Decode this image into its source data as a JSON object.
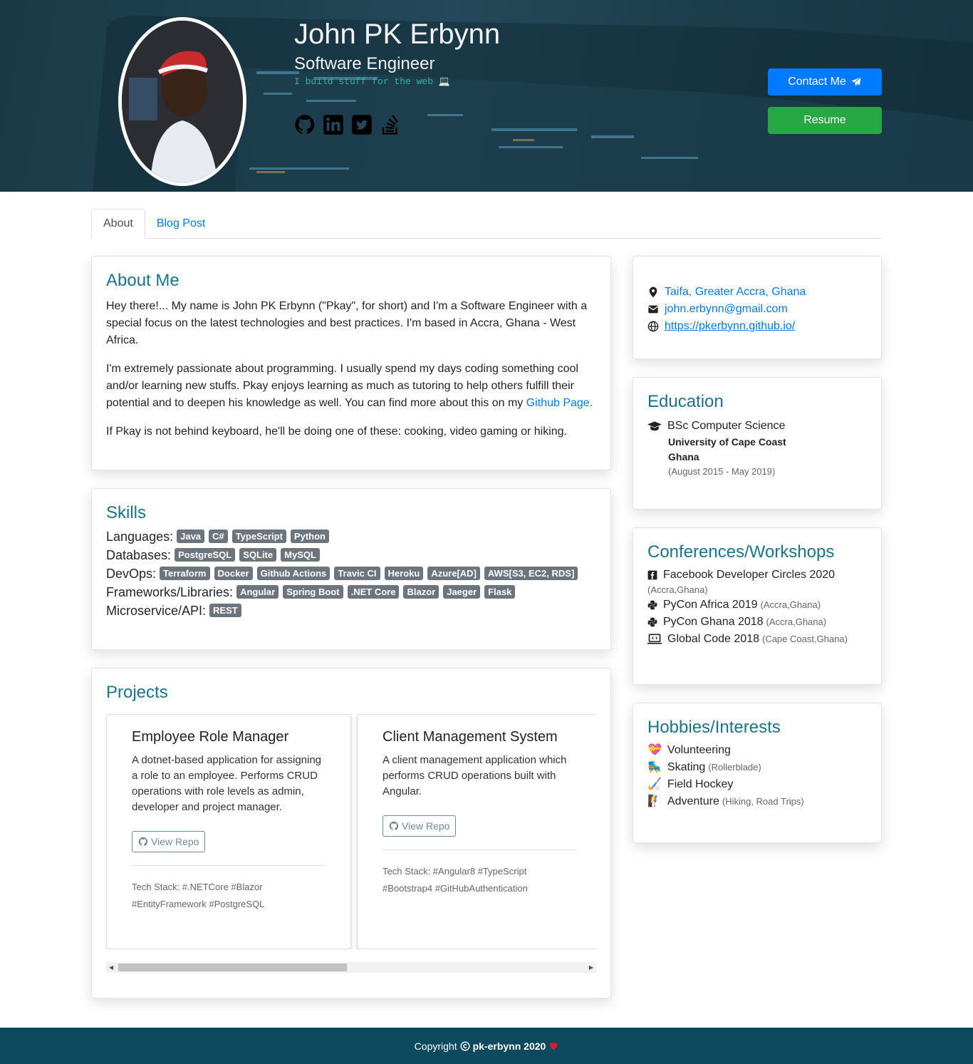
{
  "header": {
    "name": "John PK Erbynn",
    "role": "Software Engineer",
    "tagline": "I build stuff for the web 💻",
    "socials": [
      "github-icon",
      "linkedin-icon",
      "twitter-icon",
      "stackoverflow-icon"
    ],
    "contact_label": "Contact Me",
    "resume_label": "Resume"
  },
  "tabs": [
    {
      "label": "About",
      "active": true
    },
    {
      "label": "Blog Post",
      "active": false
    }
  ],
  "about": {
    "title": "About Me",
    "p1": "Hey there!... My name is John PK Erbynn (\"Pkay\", for short) and I'm a Software Engineer with a special focus on the latest technologies and best practices. I'm based in Accra, Ghana - West Africa.",
    "p2": "I'm extremely passionate about programming. I usually spend my days coding something cool and/or learning new stuffs. Pkay enjoys learning as much as tutoring to help others fulfill their potential and to deepen his knowledge as well. You can find more about this on my ",
    "p2_link": "Github Page.",
    "p3": "If Pkay is not behind keyboard, he'll be doing one of these: cooking, video gaming or hiking."
  },
  "skills": {
    "title": "Skills",
    "rows": [
      {
        "label": "Languages:",
        "items": [
          "Java",
          "C#",
          "TypeScript",
          "Python"
        ]
      },
      {
        "label": "Databases:",
        "items": [
          "PostgreSQL",
          "SQLite",
          "MySQL"
        ]
      },
      {
        "label": "DevOps:",
        "items": [
          "Terraform",
          "Docker",
          "Github Actions",
          "Travic CI",
          "Heroku",
          "Azure[AD]",
          "AWS[S3, EC2, RDS]"
        ]
      },
      {
        "label": "Frameworks/Libraries:",
        "items": [
          "Angular",
          "Spring Boot",
          ".NET Core",
          "Blazor",
          "Jaeger",
          "Flask"
        ]
      },
      {
        "label": "Microservice/API:",
        "items": [
          "REST"
        ]
      }
    ]
  },
  "projects": {
    "title": "Projects",
    "items": [
      {
        "name": "Employee Role Manager",
        "desc": "A dotnet-based application for assigning a role to an employee. Performs CRUD operations with role levels as admin, developer and project manager.",
        "repo_label": "View Repo",
        "tech_label": "Tech Stack: #.NETCore #Blazor #EntityFramework #PostgreSQL"
      },
      {
        "name": "Client Management System",
        "desc": "A client management application which performs CRUD operations built with Angular.",
        "repo_label": "View Repo",
        "tech_label": "Tech Stack: #Angular8 #TypeScript #Bootstrap4 #GitHubAuthentication"
      }
    ]
  },
  "contact": {
    "location": "Taifa, Greater Accra, Ghana",
    "email": "john.erbynn@gmail.com",
    "website": "https://pkerbynn.github.io/"
  },
  "education": {
    "title": "Education",
    "degree": "BSc Computer Science",
    "school": "University of Cape Coast",
    "country": "Ghana",
    "period": "(August 2015 - May 2019)"
  },
  "conferences": {
    "title": "Conferences/Workshops",
    "items": [
      {
        "icon": "facebook-icon",
        "name": "Facebook Developer Circles 2020",
        "place": "(Accra,Ghana)"
      },
      {
        "icon": "python-icon",
        "name": "PyCon Africa 2019",
        "place": "(Accra,Ghana)"
      },
      {
        "icon": "python-icon",
        "name": "PyCon Ghana 2018",
        "place": "(Accra,Ghana)"
      },
      {
        "icon": "laptop-code-icon",
        "name": "Global Code 2018",
        "place": "(Cape Coast,Ghana)"
      }
    ]
  },
  "hobbies": {
    "title": "Hobbies/Interests",
    "items": [
      {
        "emoji": "💝",
        "name": "Volunteering",
        "note": ""
      },
      {
        "emoji": "🛼",
        "name": "Skating",
        "note": "(Rollerblade)"
      },
      {
        "emoji": "🏑",
        "name": "Field Hockey",
        "note": ""
      },
      {
        "emoji": "🧗",
        "name": "Adventure",
        "note": "(Hiking, Road Trips)"
      }
    ]
  },
  "footer": {
    "prefix": "Copyright",
    "owner": "pk-erbynn 2020"
  },
  "colors": {
    "accent": "#007bff",
    "success": "#28a745",
    "heading": "#17758f",
    "footer": "#0d4a5f"
  }
}
